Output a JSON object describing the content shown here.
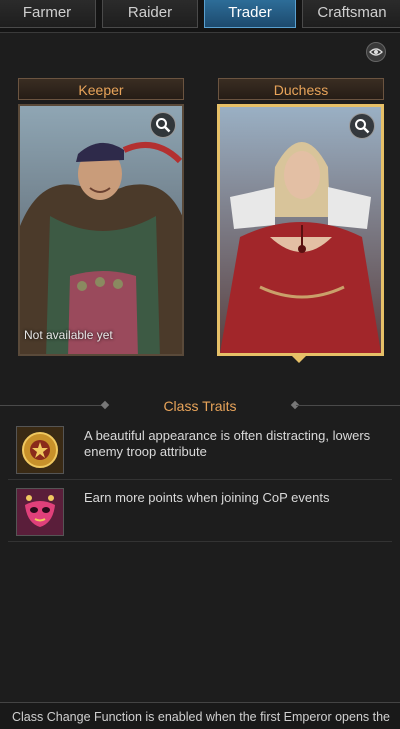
{
  "tabs": [
    {
      "label": "Farmer",
      "active": false
    },
    {
      "label": "Raider",
      "active": false
    },
    {
      "label": "Trader",
      "active": true
    },
    {
      "label": "Craftsman",
      "active": false
    }
  ],
  "characters": [
    {
      "name": "Keeper",
      "status": "Not available yet",
      "selected": false
    },
    {
      "name": "Duchess",
      "status": "",
      "selected": true
    }
  ],
  "traits": {
    "title": "Class Traits",
    "items": [
      {
        "text": "A beautiful appearance is often distracting, lowers enemy troop attribute",
        "icon": "gold-emblem-icon"
      },
      {
        "text": "Earn more points when joining CoP events",
        "icon": "festival-mask-icon"
      }
    ]
  },
  "footer": {
    "text": "Class Change Function is enabled when the first Emperor opens the"
  },
  "colors": {
    "accent": "#e8a45a",
    "active_tab": "#2d6d98",
    "selected_border": "#e6c068",
    "background": "#1d1d1d"
  }
}
